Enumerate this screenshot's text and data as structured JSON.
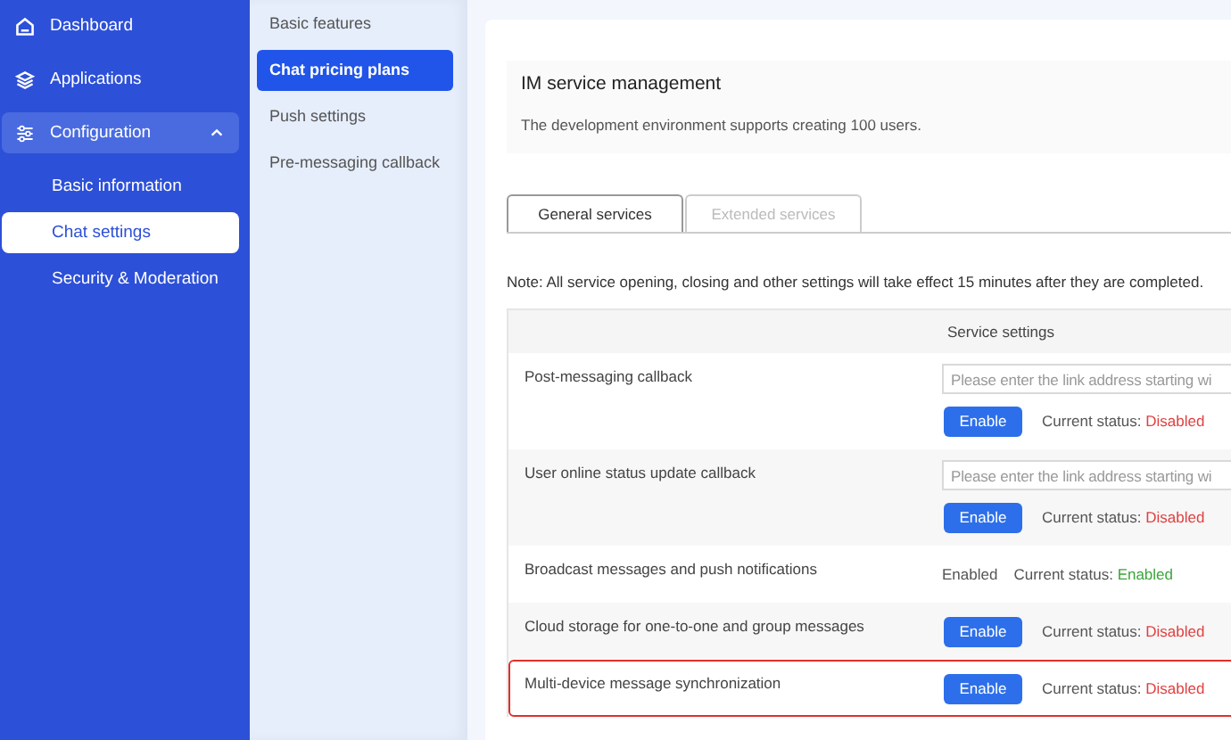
{
  "sidebar": {
    "items": [
      {
        "label": "Dashboard",
        "kind": "home",
        "selected": false
      },
      {
        "label": "Applications",
        "kind": "layers",
        "selected": false
      },
      {
        "label": "Configuration",
        "kind": "sliders",
        "selected": false,
        "expanded": true,
        "children": [
          {
            "label": "Basic information",
            "selected": false
          },
          {
            "label": "Chat settings",
            "selected": true
          },
          {
            "label": "Security & Moderation",
            "selected": false
          }
        ]
      }
    ]
  },
  "submenu": {
    "items": [
      {
        "label": "Basic features",
        "selected": false
      },
      {
        "label": "Chat pricing plans",
        "selected": true
      },
      {
        "label": "Push settings",
        "selected": false
      },
      {
        "label": "Pre-messaging callback",
        "selected": false
      }
    ]
  },
  "info": {
    "title": "IM service management",
    "description": "The development environment supports creating 100 users."
  },
  "tabs": [
    {
      "label": "General services",
      "selected": true
    },
    {
      "label": "Extended services",
      "selected": false
    }
  ],
  "note": "Note: All service opening, closing and other settings will take effect 15 minutes after they are completed.",
  "table": {
    "columns": [
      "Service settings"
    ],
    "rows": [
      {
        "kind": "callback",
        "name": "Post-messaging callback",
        "placeholder": "Please enter the link address starting wi",
        "button": "Enable",
        "status_label": "Current status:",
        "status": "Disabled",
        "enabled": false,
        "highlighted": false
      },
      {
        "kind": "callback",
        "name": "User online status update callback",
        "placeholder": "Please enter the link address starting wi",
        "button": "Enable",
        "status_label": "Current status:",
        "status": "Disabled",
        "enabled": false,
        "highlighted": false
      },
      {
        "kind": "static",
        "name": "Broadcast messages and push notifications",
        "value": "Enabled",
        "status_label": "Current status:",
        "status": "Enabled",
        "enabled": true,
        "highlighted": false
      },
      {
        "kind": "toggle",
        "name": "Cloud storage for one-to-one and group messages",
        "button": "Enable",
        "status_label": "Current status:",
        "status": "Disabled",
        "enabled": false,
        "highlighted": false
      },
      {
        "kind": "toggle",
        "name": "Multi-device message synchronization",
        "button": "Enable",
        "status_label": "Current status:",
        "status": "Disabled",
        "enabled": false,
        "highlighted": true
      }
    ]
  }
}
